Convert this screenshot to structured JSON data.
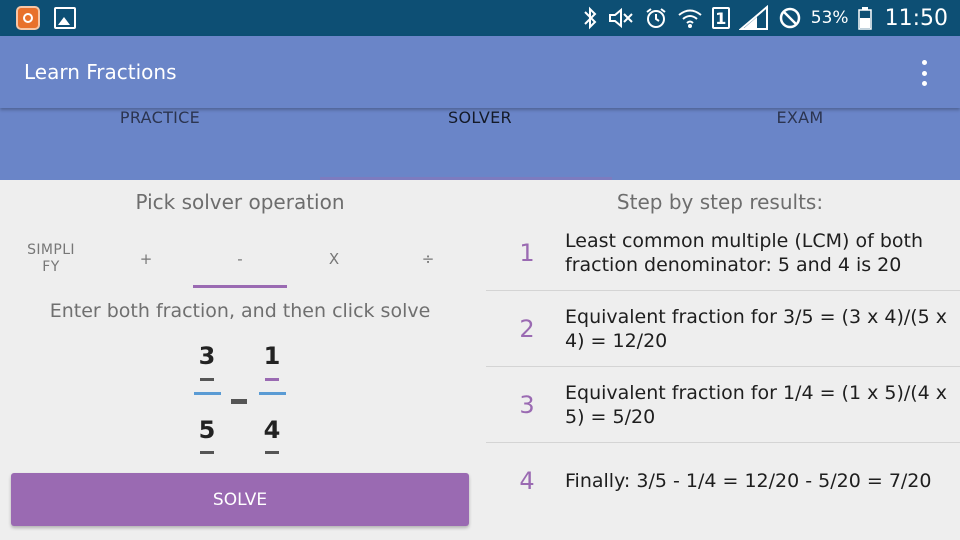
{
  "statusbar": {
    "battery_percent": "53%",
    "time": "11:50",
    "sim_badge": "1",
    "icons": [
      "app-notification-icon",
      "gallery-icon",
      "bluetooth-icon",
      "mute-icon",
      "alarm-icon",
      "wifi-icon",
      "sim-icon",
      "signal-icon",
      "do-not-disturb-icon",
      "battery-icon"
    ]
  },
  "appbar": {
    "title": "Learn Fractions"
  },
  "tabs": [
    {
      "label": "PRACTICE",
      "active": false
    },
    {
      "label": "SOLVER",
      "active": true
    },
    {
      "label": "EXAM",
      "active": false
    }
  ],
  "solver": {
    "heading": "Pick solver operation",
    "operations": [
      {
        "label": "SIMPLI\nFY",
        "active": false
      },
      {
        "label": "+",
        "active": false
      },
      {
        "label": "-",
        "active": true
      },
      {
        "label": "X",
        "active": false
      },
      {
        "label": "÷",
        "active": false
      }
    ],
    "instructions": "Enter both fraction, and then click solve",
    "fraction1": {
      "numerator": "3",
      "denominator": "5"
    },
    "fraction2": {
      "numerator": "1",
      "denominator": "4"
    },
    "solve_label": "SOLVE"
  },
  "results": {
    "heading": "Step by step results:",
    "steps": [
      {
        "number": "1",
        "text": "Least common multiple (LCM) of both fraction denominator: 5 and 4 is 20"
      },
      {
        "number": "2",
        "text": "Equivalent fraction for 3/5 = (3 x 4)/(5 x 4) = 12/20"
      },
      {
        "number": "3",
        "text": "Equivalent fraction for 1/4 = (1 x 5)/(4 x 5) = 5/20"
      },
      {
        "number": "4",
        "text": "Finally: 3/5 - 1/4 = 12/20 - 5/20 = 7/20"
      }
    ]
  },
  "colors": {
    "statusbar": "#0d4f74",
    "primary": "#6a85c8",
    "accent": "#9a6ab2",
    "fraction_bar": "#5a9bd4",
    "background": "#eeeeee"
  }
}
